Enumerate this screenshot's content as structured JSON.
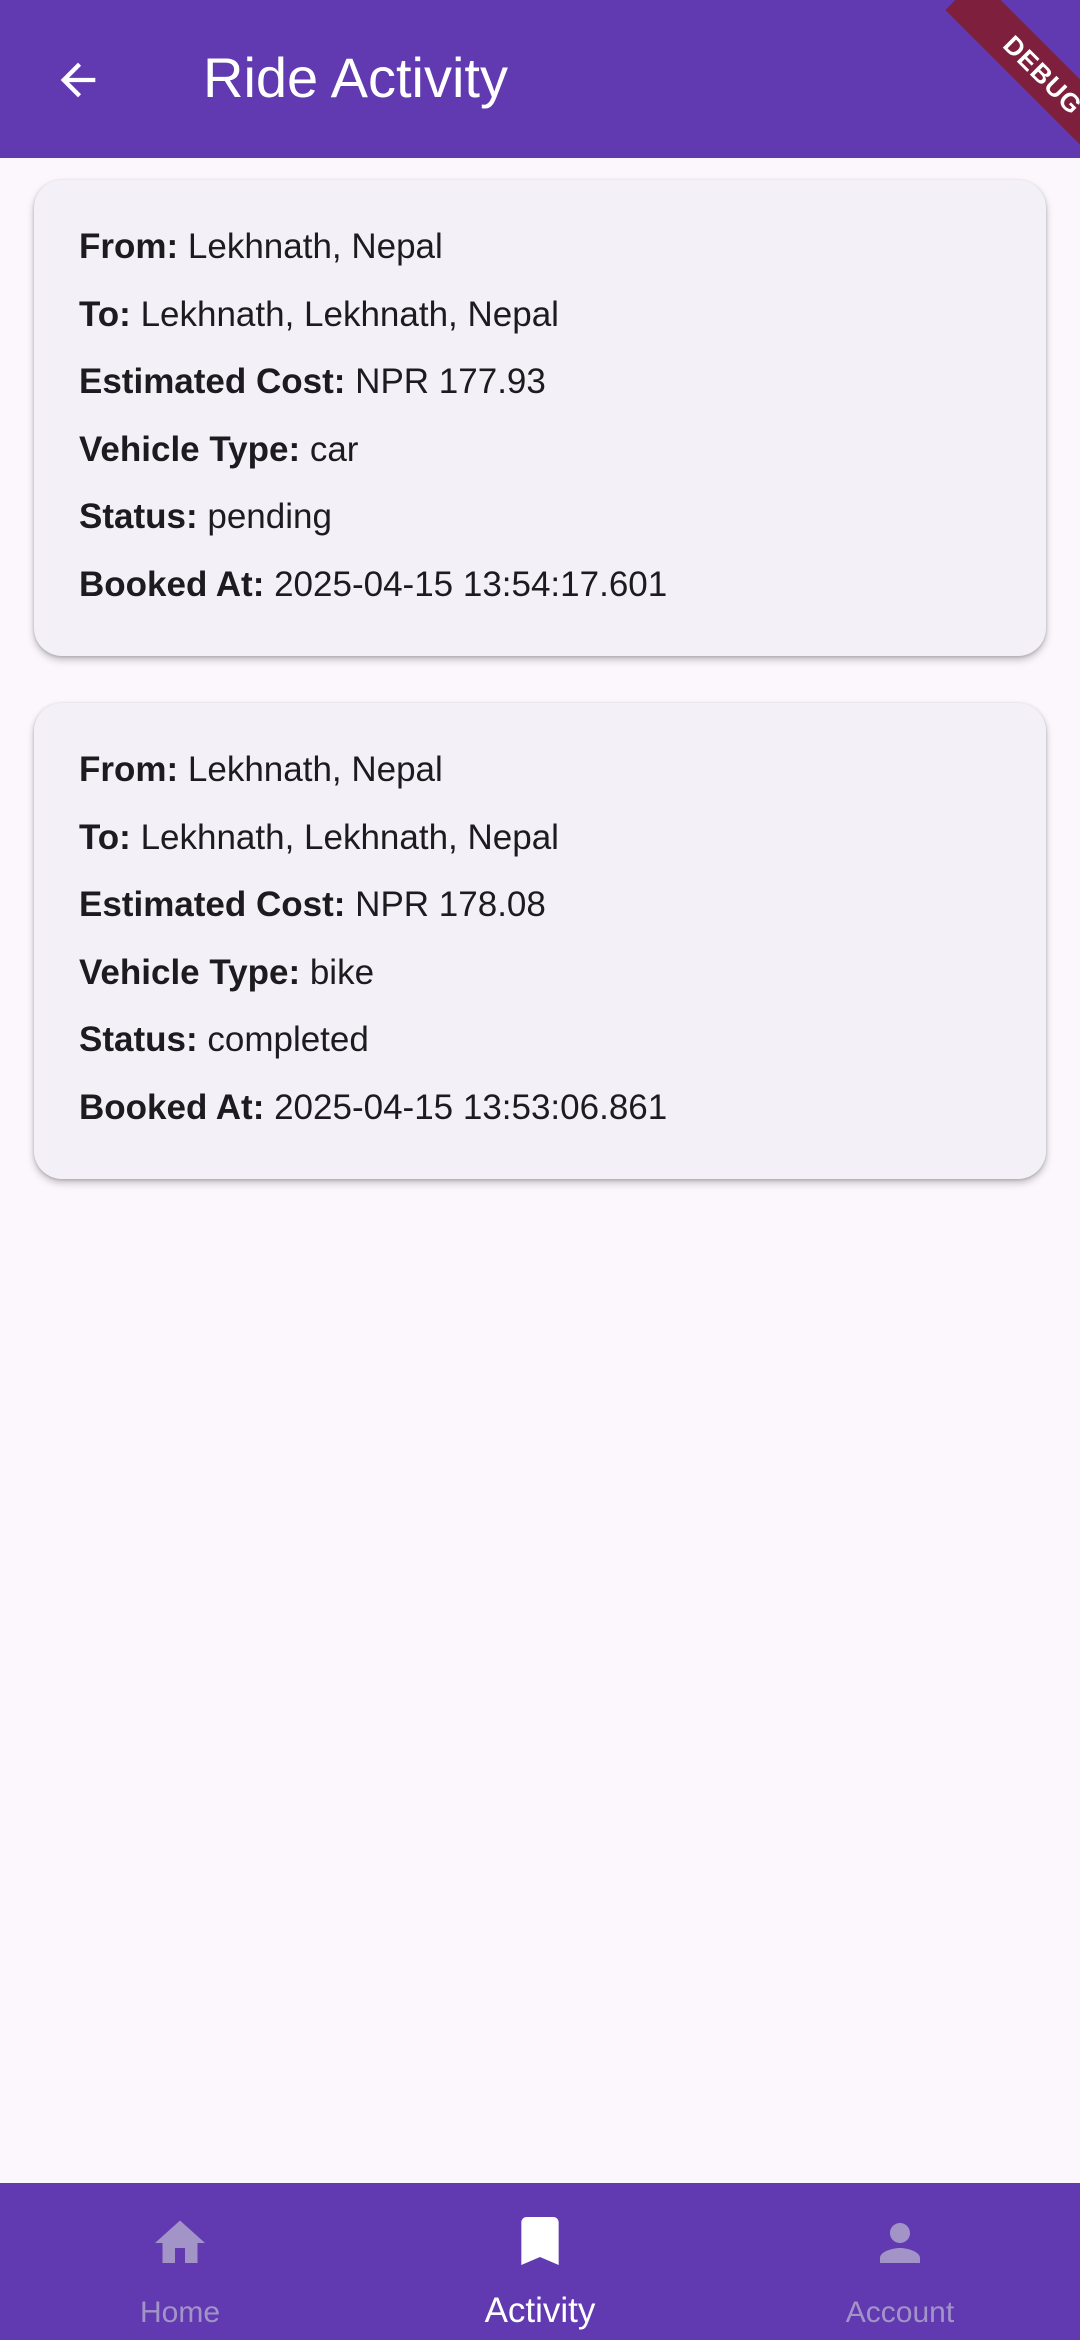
{
  "app_bar": {
    "title": "Ride Activity",
    "back_icon": "arrow-back-icon",
    "debug_banner": "DEBUG"
  },
  "rides": [
    {
      "from_label": "From:",
      "from": "Lekhnath, Nepal",
      "to_label": "To:",
      "to": "Lekhnath, Lekhnath, Nepal",
      "cost_label": "Estimated Cost:",
      "cost": "NPR 177.93",
      "vehicle_label": "Vehicle Type:",
      "vehicle": "car",
      "status_label": "Status:",
      "status": "pending",
      "booked_label": "Booked At:",
      "booked": "2025-04-15 13:54:17.601"
    },
    {
      "from_label": "From:",
      "from": "Lekhnath, Nepal",
      "to_label": "To:",
      "to": "Lekhnath, Lekhnath, Nepal",
      "cost_label": "Estimated Cost:",
      "cost": "NPR 178.08",
      "vehicle_label": "Vehicle Type:",
      "vehicle": "bike",
      "status_label": "Status:",
      "status": "completed",
      "booked_label": "Booked At:",
      "booked": "2025-04-15 13:53:06.861"
    }
  ],
  "bottom_nav": {
    "items": [
      {
        "label": "Home",
        "icon": "home-icon",
        "active": false
      },
      {
        "label": "Activity",
        "icon": "bookmark-icon",
        "active": true
      },
      {
        "label": "Account",
        "icon": "person-icon",
        "active": false
      }
    ]
  },
  "colors": {
    "primary": "#6139B1",
    "background": "#FCF7FD",
    "card": "#F3F1F7",
    "debug_banner": "#7E1F3E",
    "nav_inactive": "#A394C8"
  }
}
